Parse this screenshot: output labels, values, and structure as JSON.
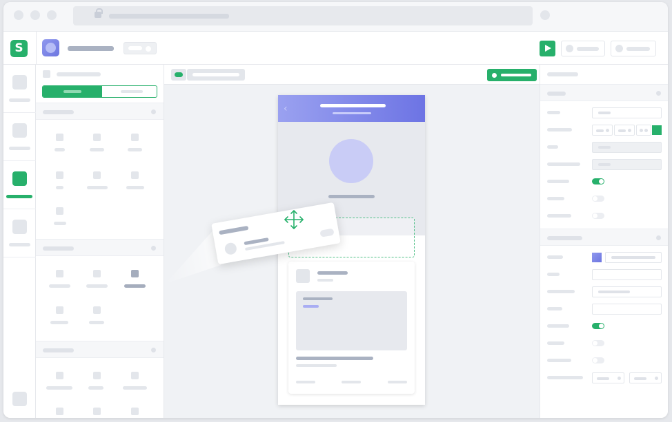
{
  "brand": {
    "logo_glyph": "S",
    "accent": "#27b06b",
    "project_gradient": [
      "#8f98ee",
      "#6d74e4"
    ]
  },
  "icons": {
    "lock": "lock-icon",
    "play": "play-icon",
    "back": "chevron-left-icon",
    "move": "move-arrows-icon"
  },
  "phone": {
    "back_glyph": "‹"
  },
  "colors": {
    "placeholder": "#e3e6eb",
    "placeholder_dark": "#aab2c2",
    "canvas_bg": "#f0f2f5"
  },
  "properties": {
    "toggles": [
      true,
      false,
      false,
      true,
      false,
      false
    ]
  }
}
